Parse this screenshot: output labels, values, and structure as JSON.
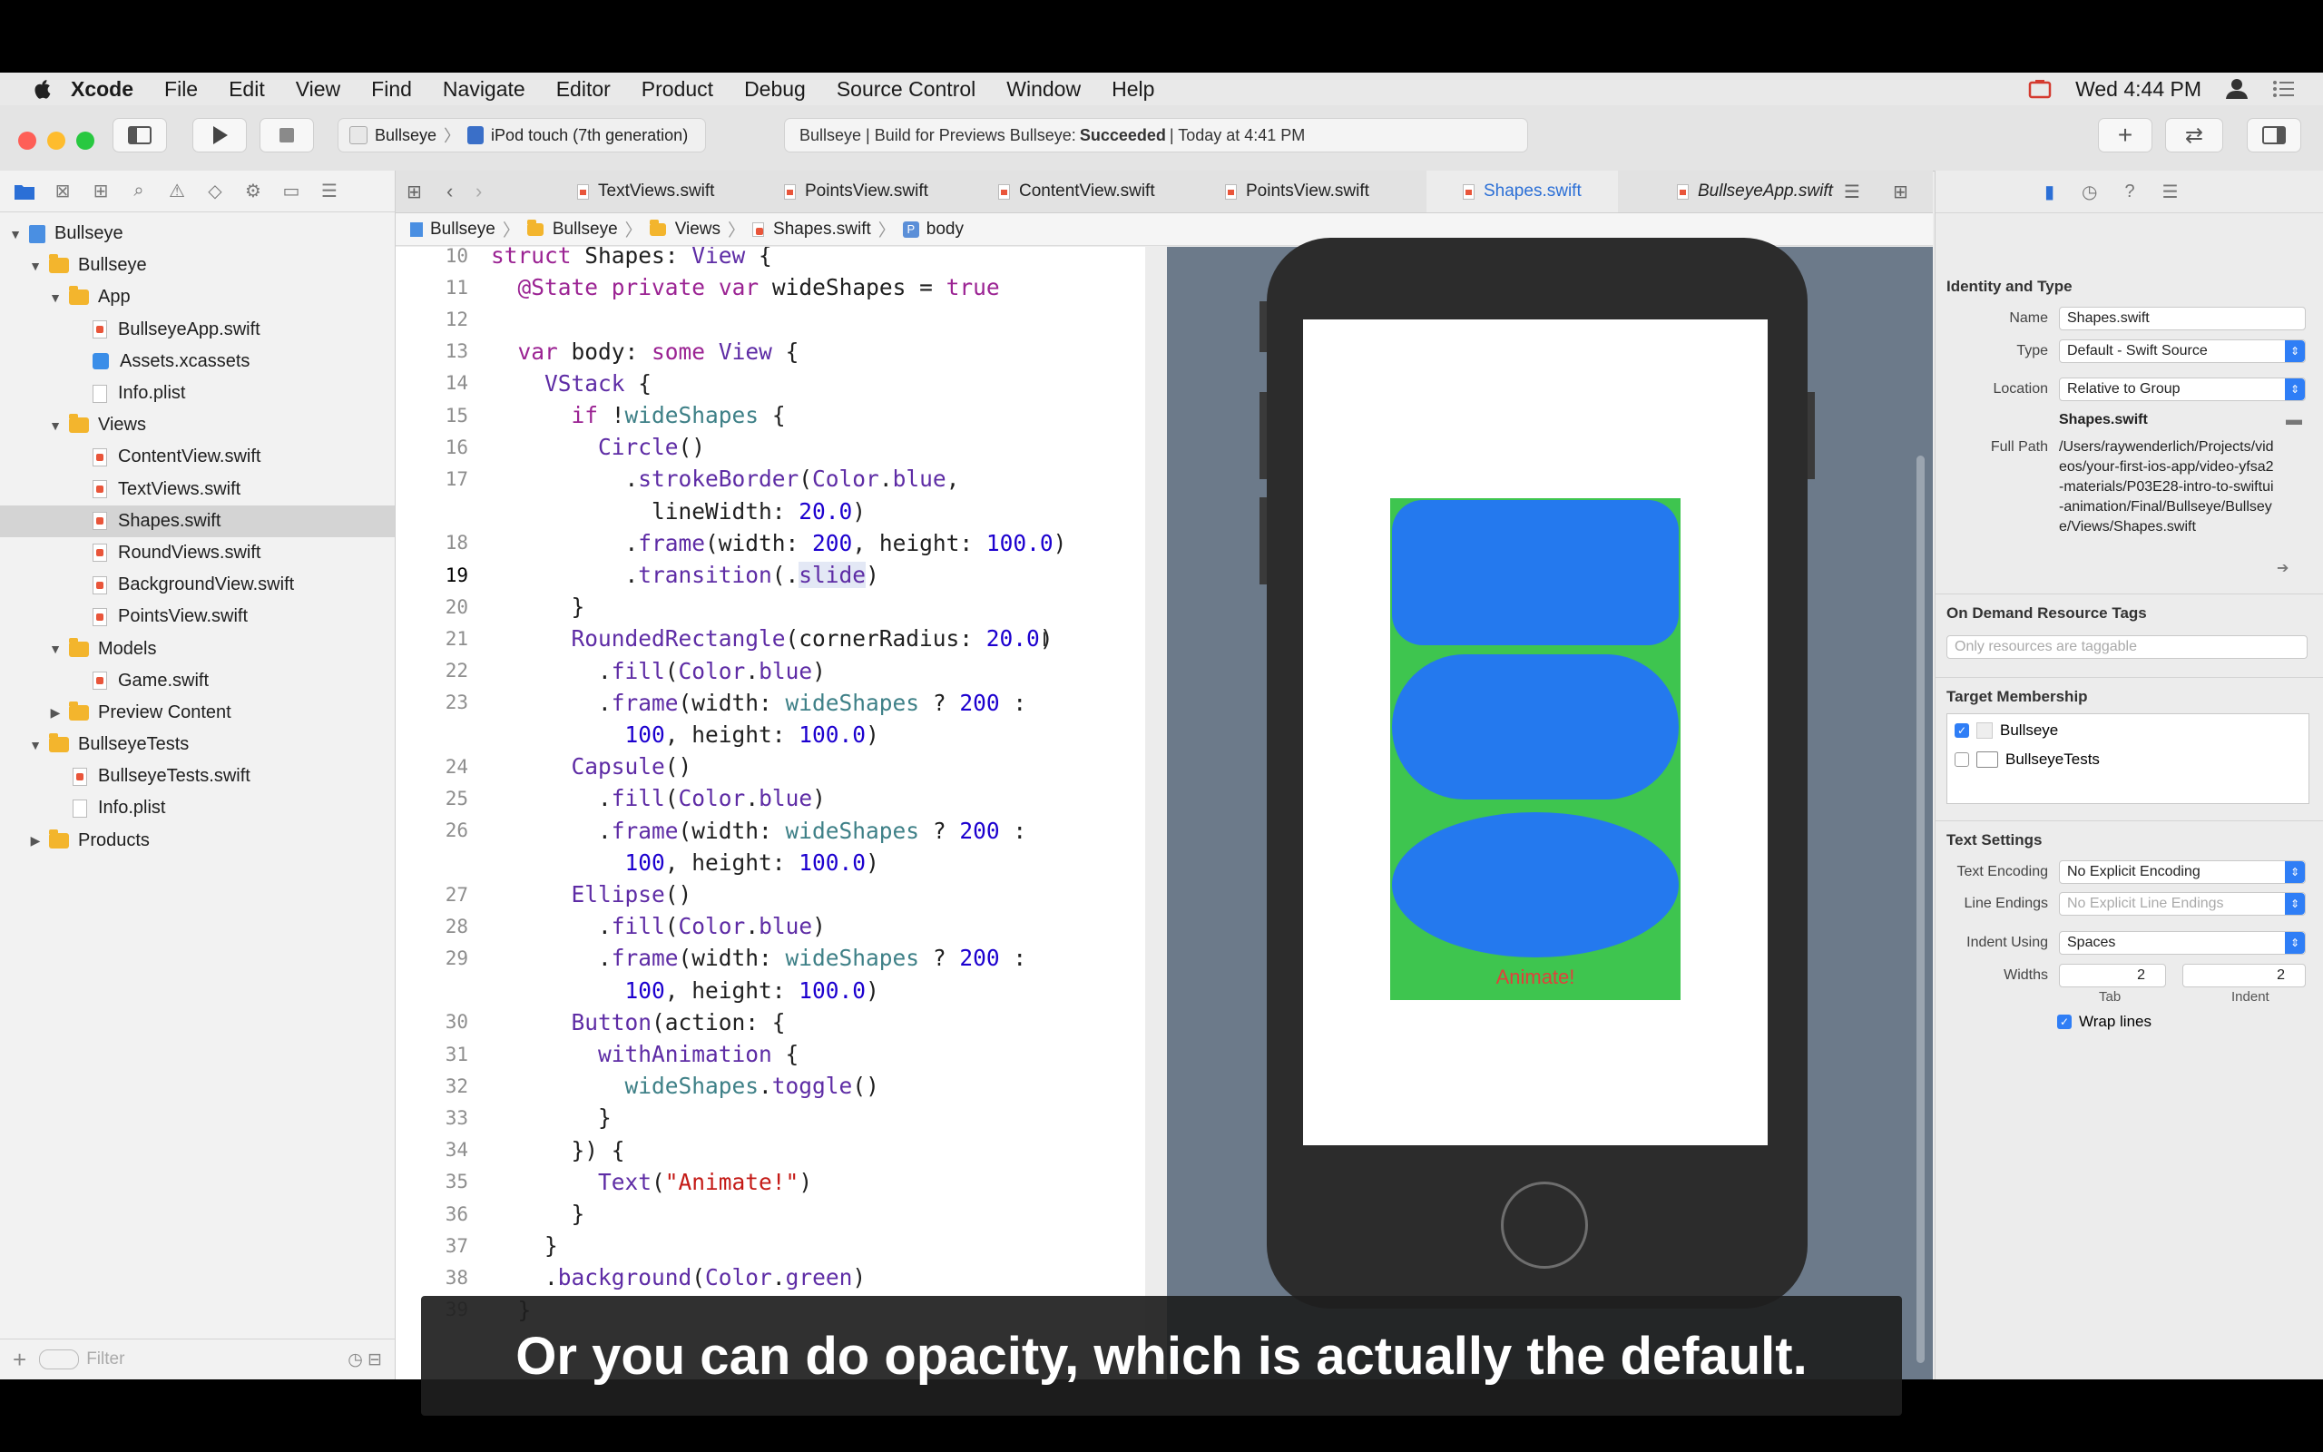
{
  "menubar": {
    "app": "Xcode",
    "items": [
      "File",
      "Edit",
      "View",
      "Find",
      "Navigate",
      "Editor",
      "Product",
      "Debug",
      "Source Control",
      "Window",
      "Help"
    ],
    "clock": "Wed 4:44 PM"
  },
  "toolbar": {
    "scheme": "Bullseye",
    "device": "iPod touch (7th generation)",
    "status_prefix": "Bullseye | Build for Previews Bullseye:",
    "status_result": "Succeeded",
    "status_time": "| Today at 4:41 PM"
  },
  "tabs": [
    {
      "label": "TextViews.swift"
    },
    {
      "label": "PointsView.swift"
    },
    {
      "label": "ContentView.swift"
    },
    {
      "label": "PointsView.swift"
    },
    {
      "label": "Shapes.swift"
    },
    {
      "label": "BullseyeApp.swift"
    }
  ],
  "jumpbar": [
    "Bullseye",
    "Bullseye",
    "Views",
    "Shapes.swift",
    "body"
  ],
  "navigator": {
    "items": [
      {
        "label": "Bullseye",
        "kind": "project",
        "level": 0,
        "open": true
      },
      {
        "label": "Bullseye",
        "kind": "folder",
        "level": 1,
        "open": true
      },
      {
        "label": "App",
        "kind": "folder",
        "level": 2,
        "open": true
      },
      {
        "label": "BullseyeApp.swift",
        "kind": "swift",
        "level": 3
      },
      {
        "label": "Assets.xcassets",
        "kind": "assets",
        "level": 3
      },
      {
        "label": "Info.plist",
        "kind": "plist",
        "level": 3
      },
      {
        "label": "Views",
        "kind": "folder",
        "level": 2,
        "open": true
      },
      {
        "label": "ContentView.swift",
        "kind": "swift",
        "level": 3
      },
      {
        "label": "TextViews.swift",
        "kind": "swift",
        "level": 3
      },
      {
        "label": "Shapes.swift",
        "kind": "swift",
        "level": 3,
        "selected": true
      },
      {
        "label": "RoundViews.swift",
        "kind": "swift",
        "level": 3
      },
      {
        "label": "BackgroundView.swift",
        "kind": "swift",
        "level": 3
      },
      {
        "label": "PointsView.swift",
        "kind": "swift",
        "level": 3
      },
      {
        "label": "Models",
        "kind": "folder",
        "level": 2,
        "open": true
      },
      {
        "label": "Game.swift",
        "kind": "swift",
        "level": 3
      },
      {
        "label": "Preview Content",
        "kind": "folder",
        "level": 2,
        "open": false
      },
      {
        "label": "BullseyeTests",
        "kind": "folder",
        "level": 1,
        "open": true
      },
      {
        "label": "BullseyeTests.swift",
        "kind": "swift",
        "level": 2
      },
      {
        "label": "Info.plist",
        "kind": "plist",
        "level": 2
      },
      {
        "label": "Products",
        "kind": "folder",
        "level": 1,
        "open": false
      }
    ],
    "filter_placeholder": "Filter"
  },
  "code": [
    {
      "n": "10",
      "t": "struct Shapes: View {"
    },
    {
      "n": "11",
      "t": "  @State private var wideShapes = true"
    },
    {
      "n": "12",
      "t": ""
    },
    {
      "n": "13",
      "t": "  var body: some View {"
    },
    {
      "n": "14",
      "t": "    VStack {"
    },
    {
      "n": "15",
      "t": "      if !wideShapes {"
    },
    {
      "n": "16",
      "t": "        Circle()"
    },
    {
      "n": "17",
      "t": "          .strokeBorder(Color.blue,"
    },
    {
      "n": "",
      "t": "            lineWidth: 20.0)"
    },
    {
      "n": "18",
      "t": "          .frame(width: 200, height: 100.0)"
    },
    {
      "n": "19",
      "t": "          .transition(.slide)"
    },
    {
      "n": "20",
      "t": "      }"
    },
    {
      "n": "21",
      "t": "      RoundedRectangle(cornerRadius: 20.0)"
    },
    {
      "n": "22",
      "t": "        .fill(Color.blue)"
    },
    {
      "n": "23",
      "t": "        .frame(width: wideShapes ? 200 :"
    },
    {
      "n": "",
      "t": "          100, height: 100.0)"
    },
    {
      "n": "24",
      "t": "      Capsule()"
    },
    {
      "n": "25",
      "t": "        .fill(Color.blue)"
    },
    {
      "n": "26",
      "t": "        .frame(width: wideShapes ? 200 :"
    },
    {
      "n": "",
      "t": "          100, height: 100.0)"
    },
    {
      "n": "27",
      "t": "      Ellipse()"
    },
    {
      "n": "28",
      "t": "        .fill(Color.blue)"
    },
    {
      "n": "29",
      "t": "        .frame(width: wideShapes ? 200 :"
    },
    {
      "n": "",
      "t": "          100, height: 100.0)"
    },
    {
      "n": "30",
      "t": "      Button(action: {"
    },
    {
      "n": "31",
      "t": "        withAnimation {"
    },
    {
      "n": "32",
      "t": "          wideShapes.toggle()"
    },
    {
      "n": "33",
      "t": "        }"
    },
    {
      "n": "34",
      "t": "      }) {"
    },
    {
      "n": "35",
      "t": "        Text(\"Animate!\")"
    },
    {
      "n": "36",
      "t": "      }"
    },
    {
      "n": "37",
      "t": "    }"
    },
    {
      "n": "38",
      "t": "    .background(Color.green)"
    },
    {
      "n": "39",
      "t": "  }"
    }
  ],
  "current_line": "19",
  "preview": {
    "button_label": "Animate!"
  },
  "inspector": {
    "identity_title": "Identity and Type",
    "name_label": "Name",
    "name_value": "Shapes.swift",
    "type_label": "Type",
    "type_value": "Default - Swift Source",
    "location_label": "Location",
    "location_value": "Relative to Group",
    "location_file": "Shapes.swift",
    "fullpath_label": "Full Path",
    "fullpath_value": "/Users/raywenderlich/Projects/videos/your-first-ios-app/video-yfsa2-materials/P03E28-intro-to-swiftui-animation/Final/Bullseye/Bullseye/Views/Shapes.swift",
    "ondemand_title": "On Demand Resource Tags",
    "ondemand_placeholder": "Only resources are taggable",
    "target_title": "Target Membership",
    "targets": [
      {
        "label": "Bullseye",
        "checked": true
      },
      {
        "label": "BullseyeTests",
        "checked": false
      }
    ],
    "text_title": "Text Settings",
    "encoding_label": "Text Encoding",
    "encoding_value": "No Explicit Encoding",
    "endings_label": "Line Endings",
    "endings_value": "No Explicit Line Endings",
    "indent_label": "Indent Using",
    "indent_value": "Spaces",
    "widths_label": "Widths",
    "tab_value": "2",
    "indent_width_value": "2",
    "tab_caption": "Tab",
    "indent_caption": "Indent",
    "wrap_label": "Wrap lines",
    "wrap_checked": true
  },
  "caption": "Or you can do opacity, which is actually the default.",
  "colors": {
    "accent": "#2b6fd6",
    "shape_blue": "#2479ee",
    "preview_green": "#3ec54f",
    "animate_red": "#e0413b"
  }
}
